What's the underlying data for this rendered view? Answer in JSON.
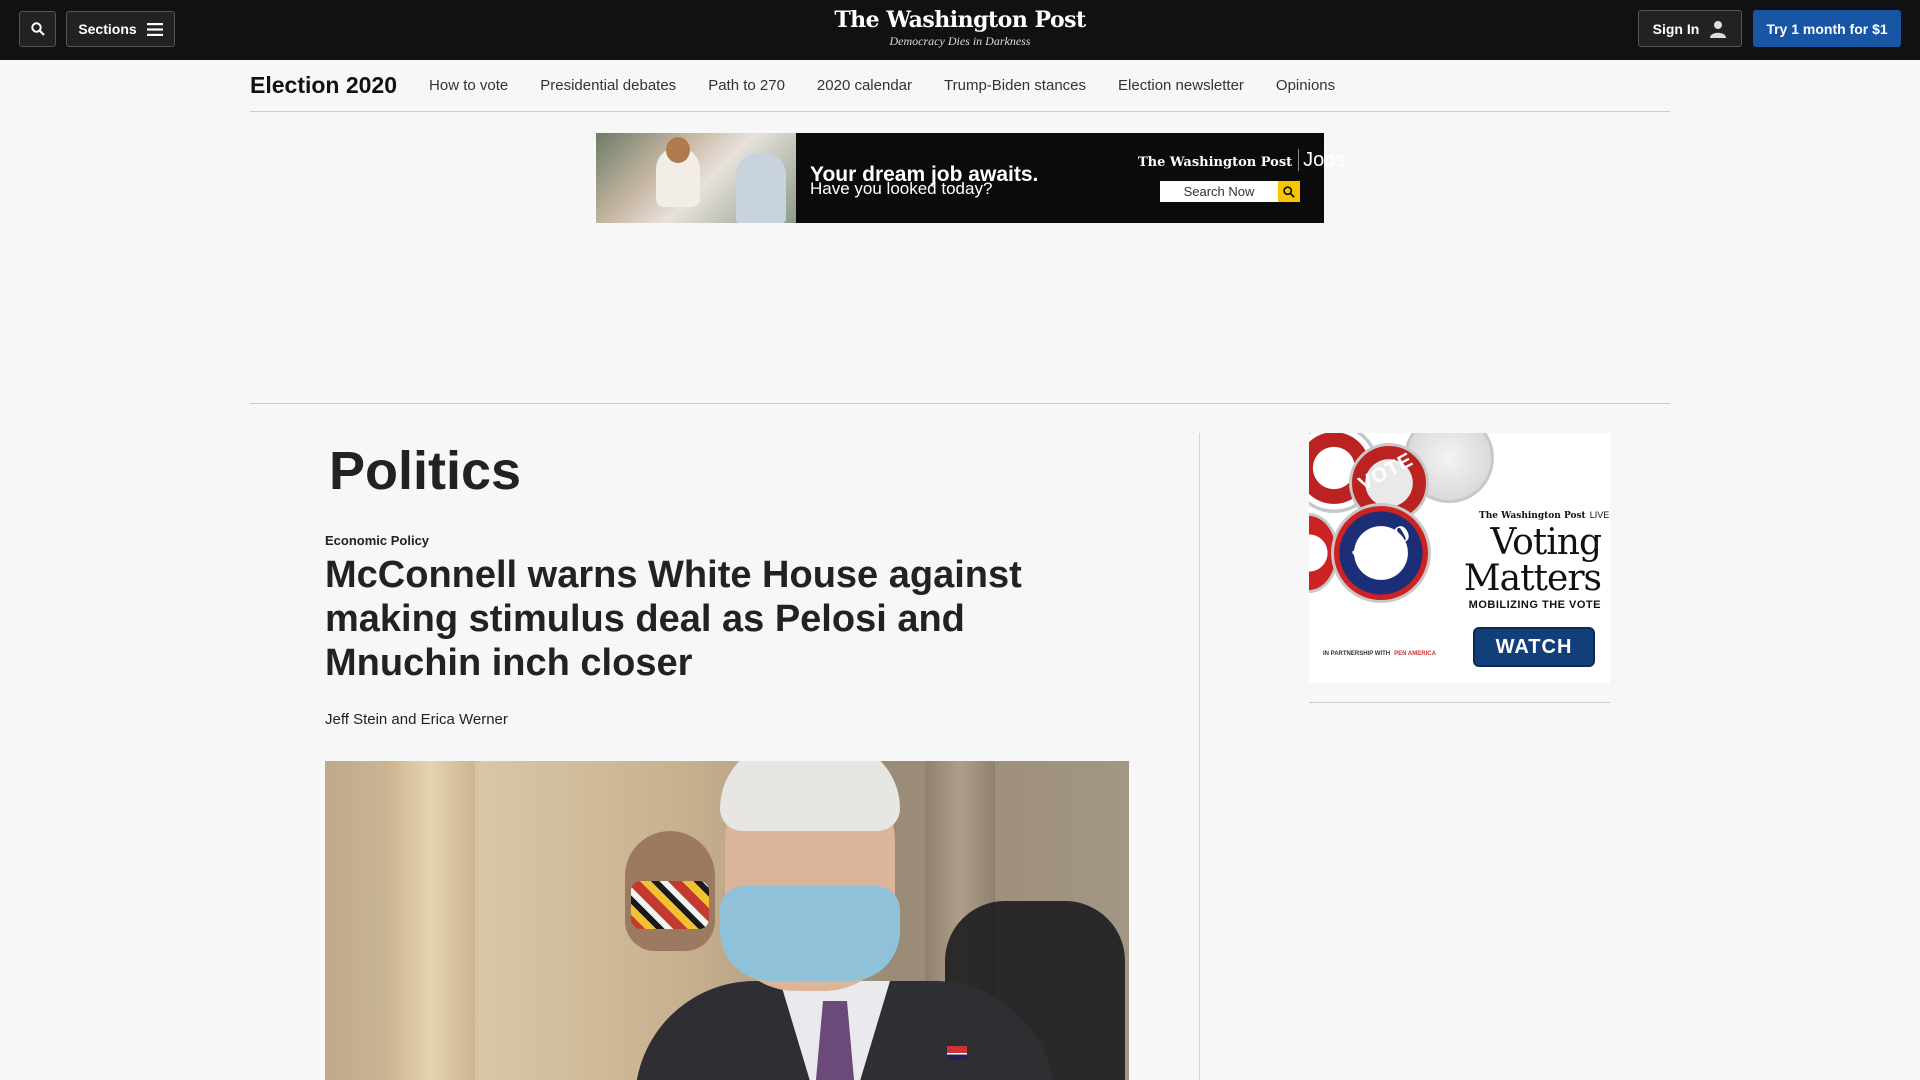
{
  "header": {
    "sections_label": "Sections",
    "logo": "The Washington Post",
    "tagline": "Democracy Dies in Darkness",
    "signin_label": "Sign In",
    "subscribe_label": "Try 1 month for $1"
  },
  "subnav": {
    "title": "Election 2020",
    "items": [
      {
        "label": "How to vote"
      },
      {
        "label": "Presidential debates"
      },
      {
        "label": "Path to 270"
      },
      {
        "label": "2020 calendar"
      },
      {
        "label": "Trump-Biden stances"
      },
      {
        "label": "Election newsletter"
      },
      {
        "label": "Opinions"
      }
    ]
  },
  "top_ad": {
    "headline": "Your dream job awaits.",
    "subline": "Have you looked today?",
    "brand": "The Washington Post",
    "brand_product": "Jobs",
    "search_label": "Search Now"
  },
  "article": {
    "section": "Politics",
    "kicker": "Economic Policy",
    "headline": "McConnell warns White House against making stimulus deal as Pelosi and Mnuchin inch closer",
    "byline": "Jeff Stein and Erica Werner"
  },
  "rail_ad": {
    "brand": "The Washington Post",
    "brand_tag": "LIVE",
    "title": "Voting Matters",
    "subtitle": "MOBILIZING THE VOTE",
    "partner": "IN PARTNERSHIP WITH",
    "partner_name": "PEN AMERICA",
    "cta": "WATCH",
    "pin_text_1": "VOTE",
    "pin_text_2": "2020"
  },
  "colors": {
    "topbar": "#111111",
    "subscribe_button": "#1955a5",
    "page_background": "#f7f7f7",
    "ad_search_button": "#f6c700",
    "watch_button": "#123e7a"
  },
  "icons": {
    "search": "search-icon",
    "menu": "hamburger-icon",
    "user": "user-icon"
  }
}
